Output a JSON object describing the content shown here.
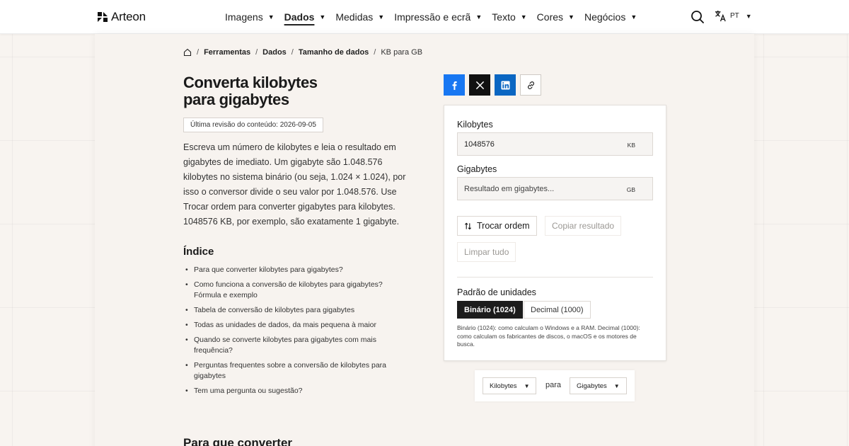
{
  "header": {
    "logo_text": "Arteon",
    "nav": [
      {
        "label": "Imagens",
        "active": false
      },
      {
        "label": "Dados",
        "active": true
      },
      {
        "label": "Medidas",
        "active": false
      },
      {
        "label": "Impressão e ecrã",
        "active": false
      },
      {
        "label": "Texto",
        "active": false
      },
      {
        "label": "Cores",
        "active": false
      },
      {
        "label": "Negócios",
        "active": false
      }
    ],
    "language": "PT",
    "icons": {
      "search": "search-icon",
      "language": "translate-icon",
      "caret": "chevron-down-icon"
    }
  },
  "breadcrumb": {
    "items": [
      "Ferramentas",
      "Dados",
      "Tamanho de dados"
    ],
    "current": "KB para GB"
  },
  "article": {
    "title_line1": "Converta kilobytes",
    "title_line2": "para gigabytes",
    "revision": "Última revisão do conteúdo: 2026-09-05",
    "intro": "Escreva um número de kilobytes e leia o resultado em gigabytes de imediato. Um gigabyte são 1.048.576 kilobytes no sistema binário (ou seja, 1.024 × 1.024), por isso o conversor divide o seu valor por 1.048.576. Use Trocar ordem para converter gigabytes para kilobytes. 1048576 KB, por exemplo, são exatamente 1 gigabyte.",
    "toc_title": "Índice",
    "toc": [
      "Para que converter kilobytes para gigabytes?",
      "Como funciona a conversão de kilobytes para gigabytes? Fórmula e exemplo",
      "Tabela de conversão de kilobytes para gigabytes",
      "Todas as unidades de dados, da mais pequena à maior",
      "Quando se converte kilobytes para gigabytes com mais frequência?",
      "Perguntas frequentes sobre a conversão de kilobytes para gigabytes",
      "Tem uma pergunta ou sugestão?"
    ],
    "next_section_title": "Para que converter"
  },
  "share": {
    "buttons": [
      {
        "name": "facebook-share-button",
        "icon": "facebook-icon",
        "color": "#1877f2"
      },
      {
        "name": "x-share-button",
        "icon": "x-icon",
        "color": "#111111"
      },
      {
        "name": "linkedin-share-button",
        "icon": "linkedin-icon",
        "color": "#0a66c2"
      },
      {
        "name": "copy-link-button",
        "icon": "link-icon",
        "color": "#ffffff"
      }
    ]
  },
  "converter": {
    "input_label": "Kilobytes",
    "input_value": "1048576",
    "input_unit": "KB",
    "output_label": "Gigabytes",
    "output_placeholder": "Resultado em gigabytes...",
    "output_unit": "GB",
    "swap_label": "Trocar ordem",
    "copy_label": "Copiar resultado",
    "clear_label": "Limpar tudo",
    "standard_label": "Padrão de unidades",
    "binary_label": "Binário (1024)",
    "decimal_label": "Decimal (1000)",
    "selected_standard": "binary",
    "standard_note": "Binário (1024): como calculam o Windows e a RAM. Decimal (1000): como calculam os fabricantes de discos, o macOS e os motores de busca."
  },
  "unit_selector": {
    "from": "Kilobytes",
    "to_word": "para",
    "to": "Gigabytes"
  },
  "colors": {
    "accent_dark": "#1c1c1c",
    "page_bg": "#f8f4f0",
    "card_bg": "#f7f3ef"
  }
}
